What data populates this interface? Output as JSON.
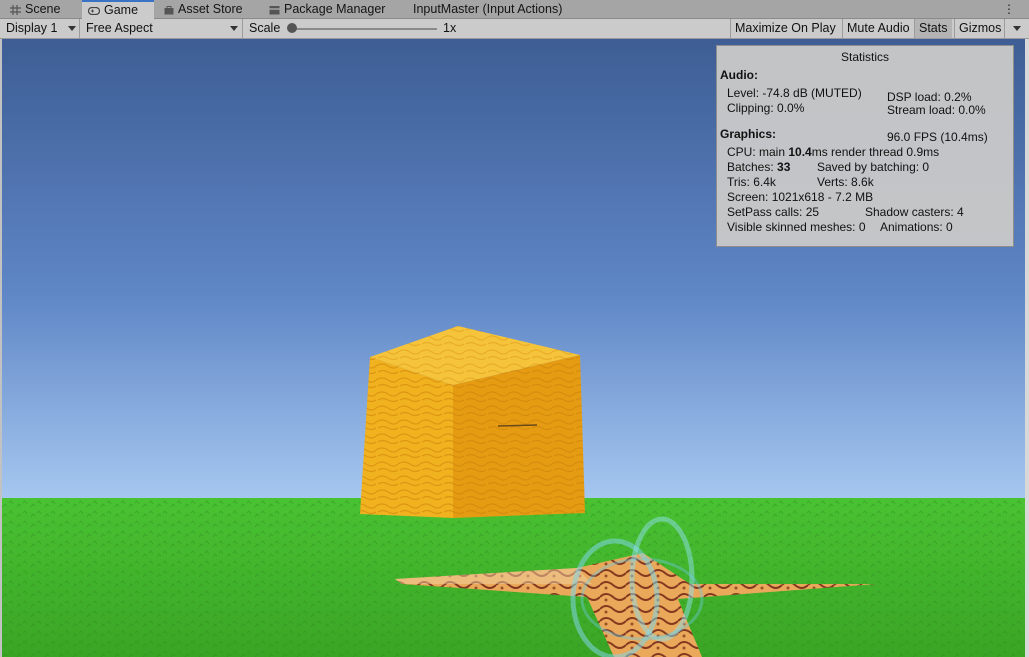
{
  "tabs": [
    {
      "label": "Scene",
      "icon": "grid-icon"
    },
    {
      "label": "Game",
      "icon": "gamepad-icon"
    },
    {
      "label": "Asset Store",
      "icon": "bag-icon"
    },
    {
      "label": "Package Manager",
      "icon": "package-icon"
    },
    {
      "label": "InputMaster (Input Actions)",
      "icon": ""
    }
  ],
  "active_tab": "Game",
  "tab_menu": "⋮",
  "toolbar": {
    "display": "Display 1",
    "aspect": "Free Aspect",
    "scale_label": "Scale",
    "scale_value": "1x",
    "scale_slider": 0.0,
    "maximize": "Maximize On Play",
    "mute": "Mute Audio",
    "stats": "Stats",
    "gizmos": "Gizmos"
  },
  "stats": {
    "title": "Statistics",
    "audio_header": "Audio:",
    "level": "Level: -74.8 dB (MUTED)",
    "clipping": "Clipping: 0.0%",
    "dsp": "DSP load: 0.2%",
    "stream": "Stream load: 0.0%",
    "graphics_header": "Graphics:",
    "fps": "96.0 FPS (10.4ms)",
    "cpu_prefix": "CPU: main ",
    "cpu_main": "10.4",
    "cpu_suffix": "ms  render thread 0.9ms",
    "batches_prefix": "Batches: ",
    "batches": "33",
    "saved_batching": "Saved by batching: 0",
    "tris": "Tris: 6.4k",
    "verts": "Verts: 8.6k",
    "screen": "Screen: 1021x618 - 7.2 MB",
    "setpass": "SetPass calls: 25",
    "shadow": "Shadow casters: 4",
    "skinned": "Visible skinned meshes: 0",
    "animations": "Animations: 0"
  },
  "colors": {
    "sky_top": "#3d5d94",
    "sky_bottom": "#a6c8f0",
    "grass": "#42b62c",
    "cube_front": "#f1b21f",
    "cube_side": "#e59c12",
    "cube_top": "#f6c43a",
    "accent": "#3a72c4"
  }
}
